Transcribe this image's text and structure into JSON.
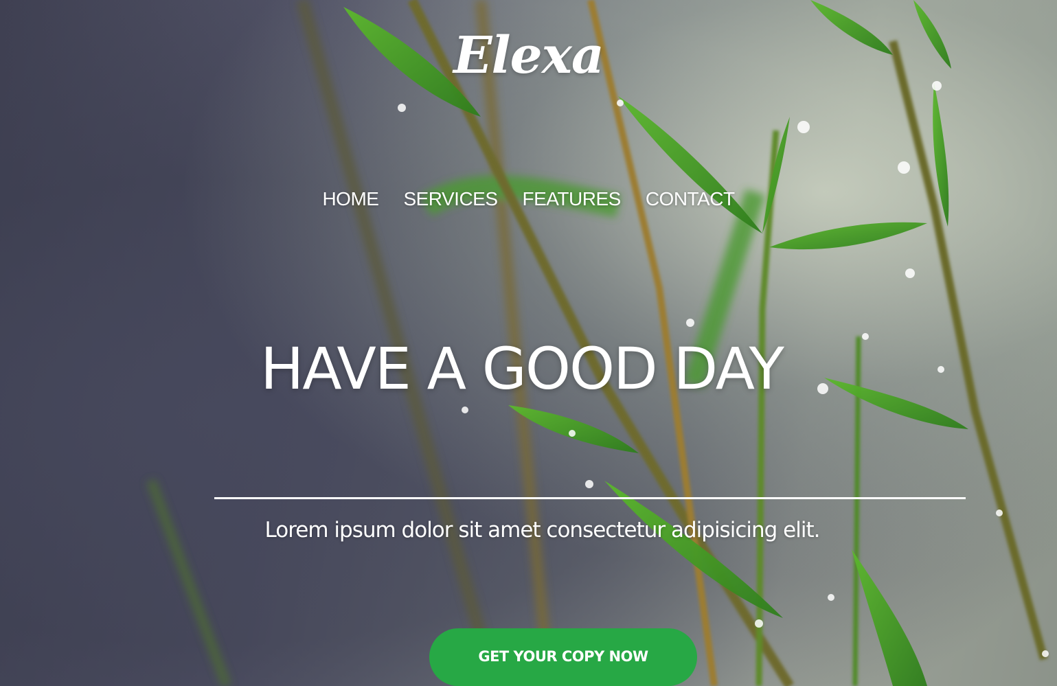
{
  "brand": {
    "logo_text": "Elexa"
  },
  "nav": {
    "items": [
      {
        "label": "HOME"
      },
      {
        "label": "SERVICES"
      },
      {
        "label": "FEATURES"
      },
      {
        "label": "CONTACT"
      }
    ]
  },
  "hero": {
    "headline": "HAVE A GOOD DAY",
    "subtext": "Lorem ipsum dolor sit amet consectetur adipisicing elit.",
    "cta_label": "GET YOUR COPY NOW",
    "background_image": "green-grass-with-dew-drops"
  },
  "colors": {
    "accent": "#27a845",
    "text": "#ffffff"
  }
}
